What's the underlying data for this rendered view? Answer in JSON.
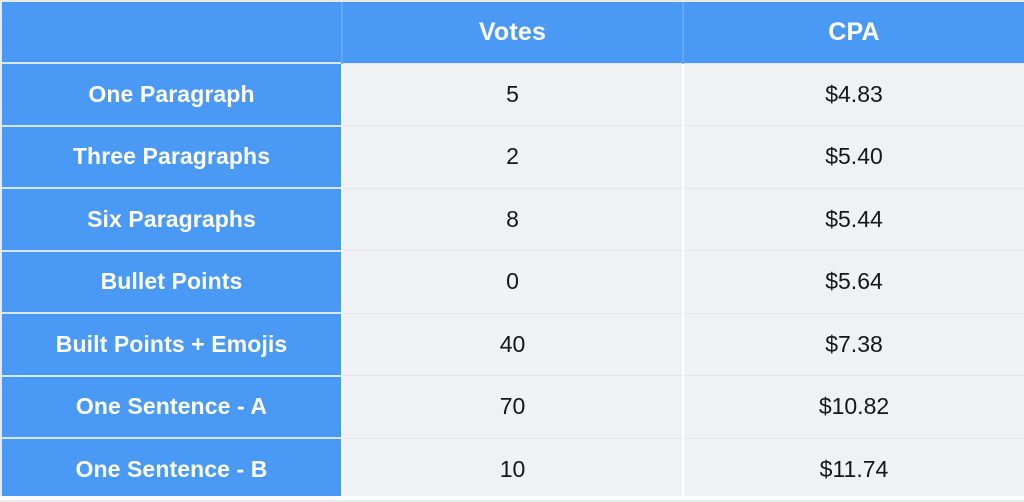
{
  "table": {
    "columns": [
      {
        "key": "label",
        "header": "",
        "align": "center"
      },
      {
        "key": "votes",
        "header": "Votes",
        "align": "center"
      },
      {
        "key": "cpa",
        "header": "CPA",
        "align": "center"
      }
    ],
    "rows": [
      {
        "label": "One Paragraph",
        "votes": "5",
        "cpa": "$4.83"
      },
      {
        "label": "Three Paragraphs",
        "votes": "2",
        "cpa": "$5.40"
      },
      {
        "label": "Six Paragraphs",
        "votes": "8",
        "cpa": "$5.44"
      },
      {
        "label": "Bullet Points",
        "votes": "0",
        "cpa": "$5.64"
      },
      {
        "label": "Built Points + Emojis",
        "votes": "40",
        "cpa": "$7.38"
      },
      {
        "label": "One Sentence - A",
        "votes": "70",
        "cpa": "$10.82"
      },
      {
        "label": "One Sentence - B",
        "votes": "10",
        "cpa": "$11.74"
      }
    ]
  },
  "chart_data": {
    "type": "table",
    "title": "",
    "categories": [
      "One Paragraph",
      "Three Paragraphs",
      "Six Paragraphs",
      "Bullet Points",
      "Built Points + Emojis",
      "One Sentence - A",
      "One Sentence - B"
    ],
    "series": [
      {
        "name": "Votes",
        "values": [
          5,
          2,
          8,
          0,
          40,
          70,
          10
        ]
      },
      {
        "name": "CPA",
        "values": [
          4.83,
          5.4,
          5.44,
          5.64,
          7.38,
          10.82,
          11.74
        ]
      }
    ],
    "column_headers": [
      "",
      "Votes",
      "CPA"
    ],
    "cpa_display": [
      "$4.83",
      "$5.40",
      "$5.44",
      "$5.64",
      "$7.38",
      "$10.82",
      "$11.74"
    ],
    "votes_display": [
      "5",
      "2",
      "8",
      "0",
      "40",
      "70",
      "10"
    ]
  },
  "colors": {
    "header_blue": "#4a9af5",
    "label_blue": "#4a9af5",
    "cell_background": "#f0f1f5",
    "header_text": "#ffffff",
    "cell_text": "#15161a",
    "row_divider": "#e4e6eb",
    "blue_row_divider": "#d7e7fb",
    "outer_border": "#e9eaee"
  }
}
